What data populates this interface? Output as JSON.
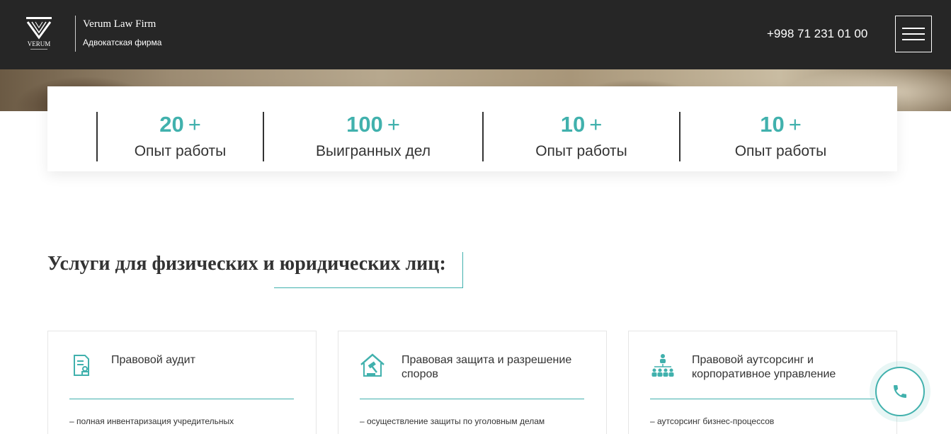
{
  "header": {
    "brand_name": "Verum Law Firm",
    "brand_sub": "Адвокатская фирма",
    "logo_text": "VERUM",
    "phone": "+998 71 231 01 00",
    "menu_icon": "hamburger-icon"
  },
  "stats": [
    {
      "number": "20",
      "suffix": "+",
      "label": "Опыт работы"
    },
    {
      "number": "100",
      "suffix": "+",
      "label": "Выигранных дел"
    },
    {
      "number": "10",
      "suffix": "+",
      "label": "Опыт работы"
    },
    {
      "number": "10",
      "suffix": "+",
      "label": "Опыт работы"
    }
  ],
  "services": {
    "title": "Услуги для физических и юридических лиц:",
    "cards": [
      {
        "icon": "document-audit-icon",
        "title": "Правовой аудит",
        "text": "– полная инвентаризация учредительных"
      },
      {
        "icon": "gavel-house-icon",
        "title": "Правовая защита и разрешение споров",
        "text": "– осуществление защиты по уголовным делам"
      },
      {
        "icon": "org-structure-icon",
        "title": "Правовой аутсорсинг и корпоративное управление",
        "text": "– аутсорсинг бизнес-процессов"
      }
    ]
  },
  "call_button": {
    "icon": "phone-icon"
  },
  "colors": {
    "accent": "#41b1ad",
    "header_bg": "#262626",
    "text": "#333333"
  }
}
